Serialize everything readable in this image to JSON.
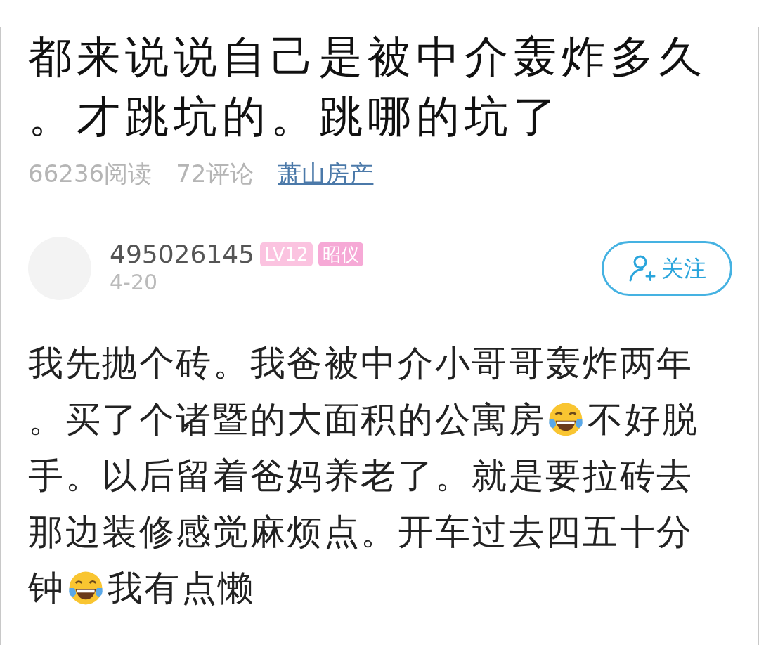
{
  "post": {
    "title": "都来说说自己是被中介轰炸多久。才跳坑的。跳哪的坑了",
    "reads": "66236阅读",
    "comments": "72评论",
    "category": "萧山房产"
  },
  "author": {
    "name": "495026145",
    "badges": [
      {
        "text": "LV12",
        "color": "#fbc3e0"
      },
      {
        "text": "昭仪",
        "color": "#f6a9d6"
      }
    ],
    "date": "4-20",
    "follow_button": "关注"
  },
  "body": [
    [
      {
        "kind": "text",
        "text": "我先抛个砖。我爸被中介小哥哥轰炸两年"
      }
    ],
    [
      {
        "kind": "text",
        "text": "。买了个诸暨的大面积的公寓房"
      },
      {
        "kind": "emoji"
      },
      {
        "kind": "text",
        "text": "不好脱"
      }
    ],
    [
      {
        "kind": "text",
        "text": "手。以后留着爸妈养老了。就是要拉砖去"
      }
    ],
    [
      {
        "kind": "text",
        "text": "那边装修感觉麻烦点。开车过去四五十分"
      }
    ],
    [
      {
        "kind": "text",
        "text": "钟"
      },
      {
        "kind": "emoji"
      },
      {
        "kind": "text",
        "text": "我有点懒"
      }
    ]
  ]
}
